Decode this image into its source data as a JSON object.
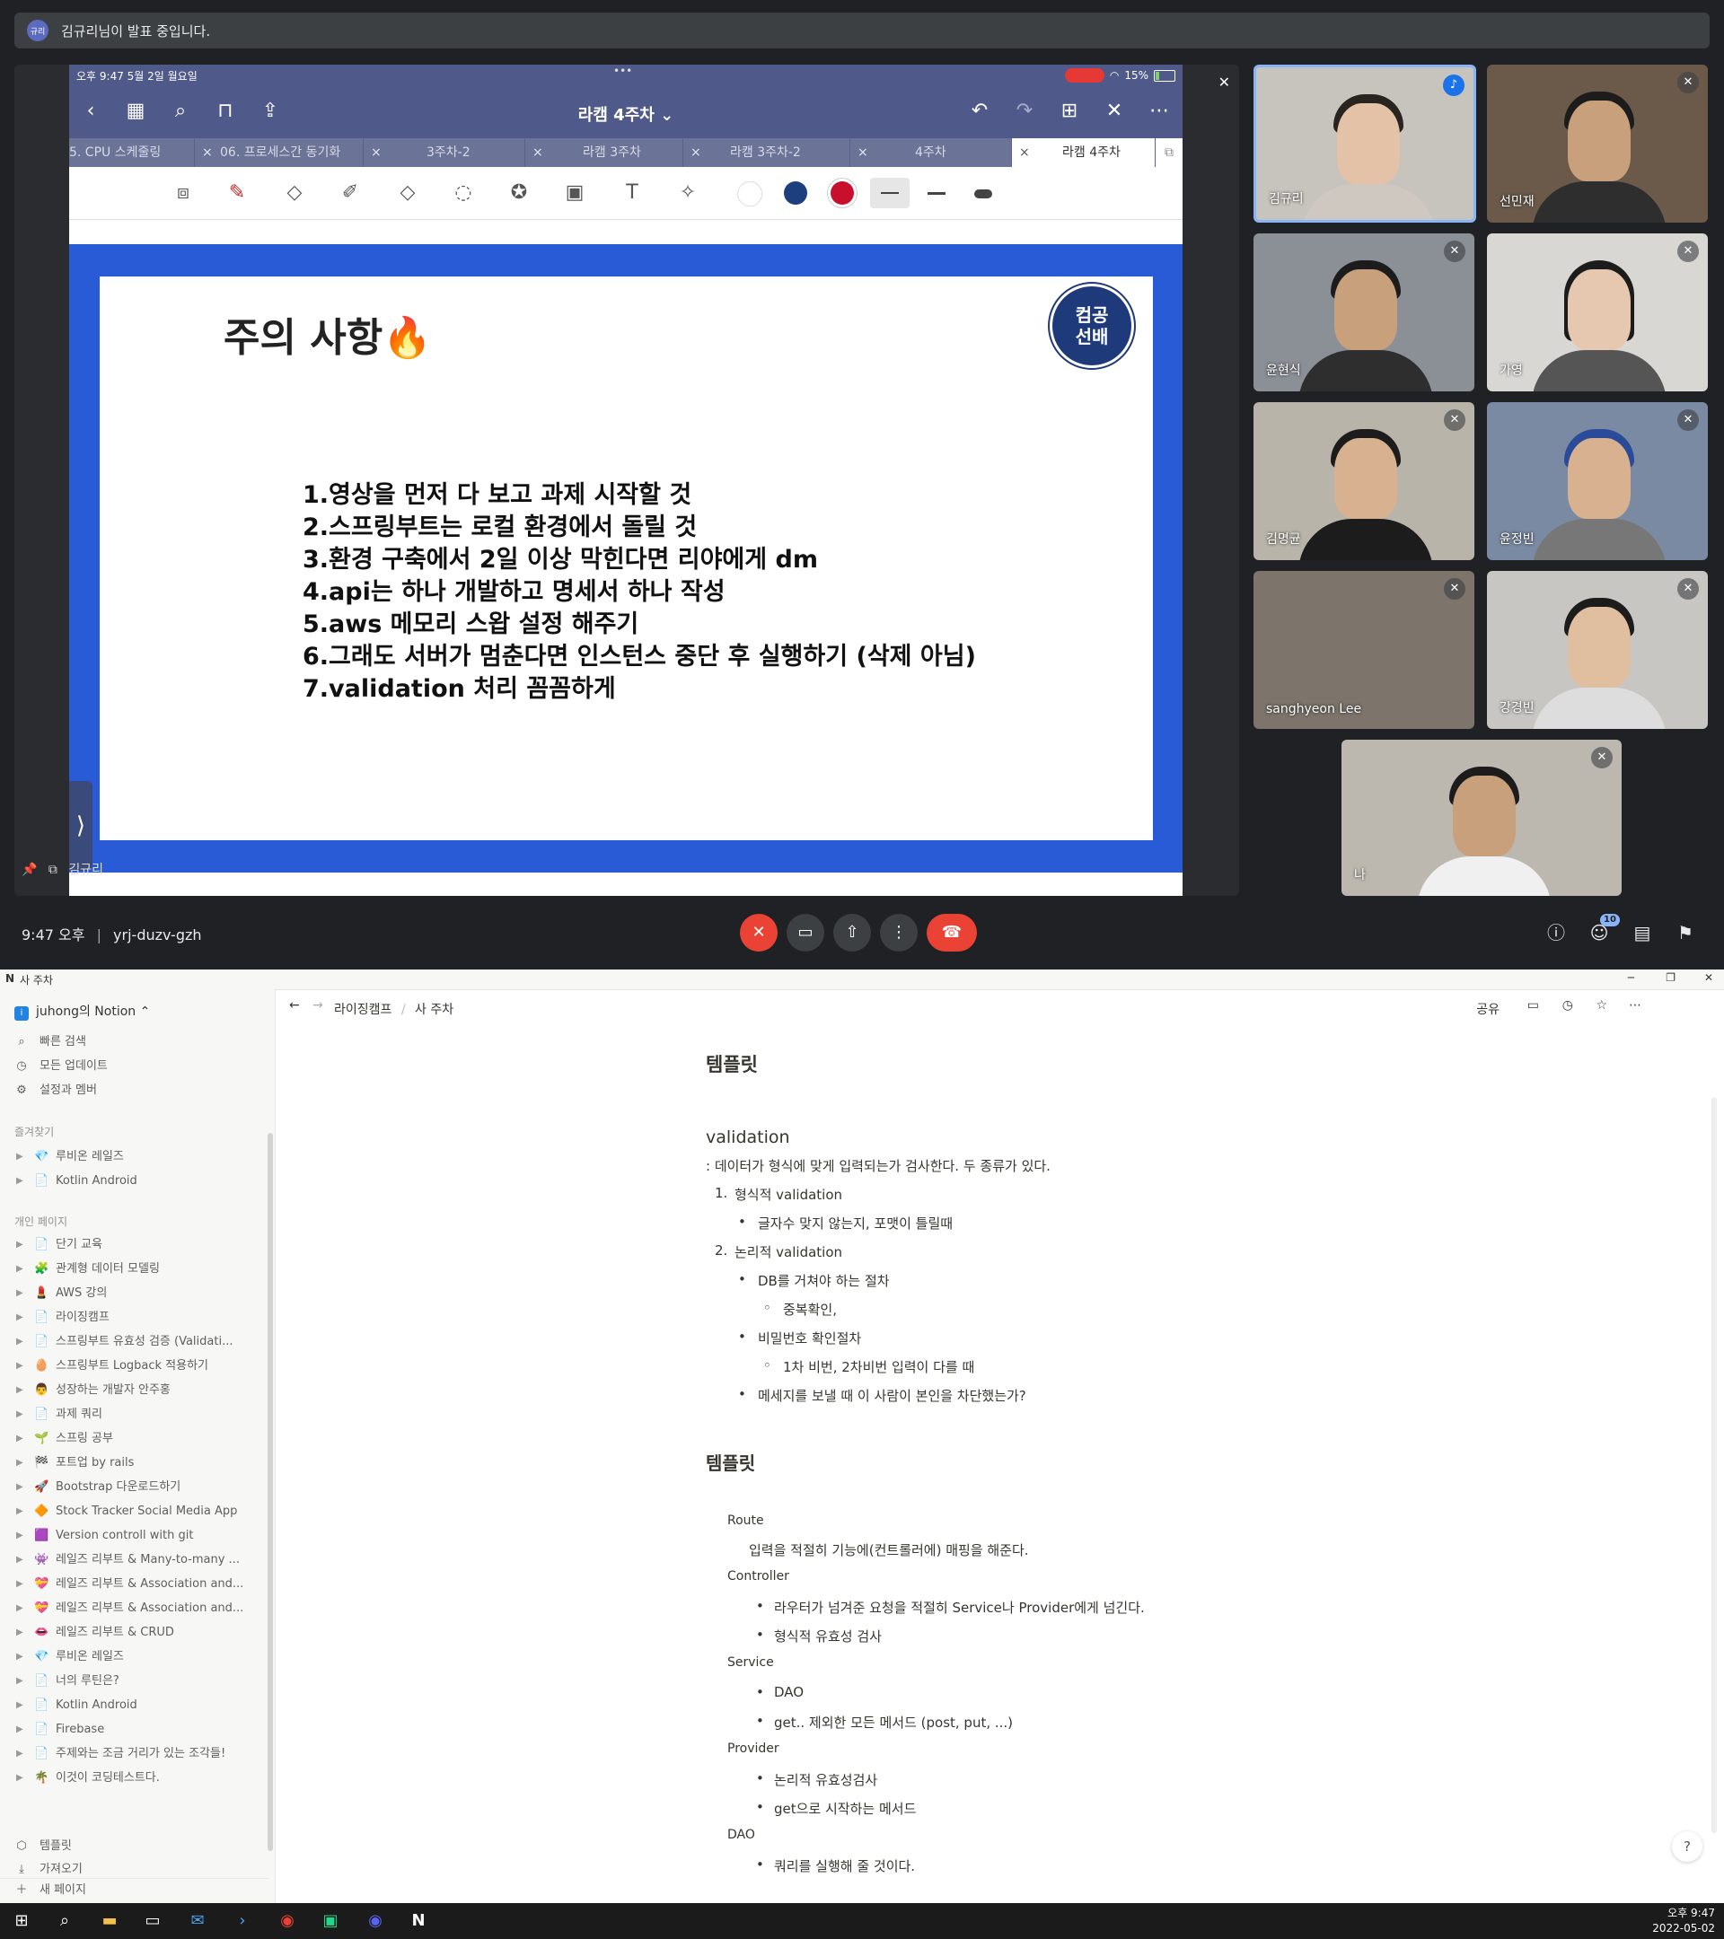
{
  "banner": {
    "avatar": "규리",
    "text": "김규리님이 발표 중입니다."
  },
  "ipad": {
    "status_time": "오후 9:47   5월 2일 월요일",
    "battery": "15%",
    "doc_title": "라캠 4주차 ⌄",
    "tabs": [
      "5. CPU 스케줄링",
      "06. 프로세스간 동기화",
      "3주차-2",
      "라캠 3주차",
      "라캠 3주차-2",
      "4주차",
      "라캠 4주차"
    ],
    "colors": {
      "toolbar": "#4f5a8a",
      "tabs": "#6b7396",
      "slide_frame": "#2a5bd7"
    }
  },
  "slide": {
    "title": "주의 사항🔥",
    "logo_line1": "컴공",
    "logo_line2": "선배",
    "items": [
      "1.영상을 먼저 다 보고 과제 시작할 것",
      "2.스프링부트는 로컬 환경에서 돌릴 것",
      "3.환경 구축에서 2일 이상 막힌다면 리야에게 dm",
      "4.api는 하나 개발하고 명세서 하나 작성",
      "5.aws 메모리 스왑 설정 해주기",
      "6.그래도 서버가 멈춘다면 인스턴스 중단 후 실행하기 (삭제 아님)",
      "7.validation 처리 꼼꼼하게"
    ]
  },
  "presenter_label": "김규리",
  "participants": [
    "김규리",
    "선민재",
    "윤현식",
    "가영",
    "김명균",
    "윤정빈",
    "sanghyeon Lee",
    "강경빈",
    "나"
  ],
  "meet_bar": {
    "time": "9:47 오후",
    "code": "yrj-duzv-gzh",
    "people_count": "10"
  },
  "notion": {
    "window_title": "사 주차",
    "workspace": "juhong의 Notion",
    "nav": [
      "빠른 검색",
      "모든 업데이트",
      "설정과 멤버"
    ],
    "favorites_label": "즐겨찾기",
    "favorites": [
      {
        "icon": "💎",
        "label": "루비온 레일즈"
      },
      {
        "icon": "📄",
        "label": "Kotlin Android"
      }
    ],
    "private_label": "개인 페이지",
    "pages": [
      {
        "icon": "📄",
        "label": "단기 교육"
      },
      {
        "icon": "🧩",
        "label": "관계형 데이터 모델링"
      },
      {
        "icon": "💄",
        "label": "AWS 강의"
      },
      {
        "icon": "📄",
        "label": "라이징캠프"
      },
      {
        "icon": "📄",
        "label": "스프링부트 유효성 검증 (Validati..."
      },
      {
        "icon": "🥚",
        "label": "스프링부트 Logback 적용하기"
      },
      {
        "icon": "👨",
        "label": "성장하는 개발자 안주홍"
      },
      {
        "icon": "📄",
        "label": "과제 쿼리"
      },
      {
        "icon": "🌱",
        "label": "스프링 공부"
      },
      {
        "icon": "🏁",
        "label": "포트업 by rails"
      },
      {
        "icon": "🚀",
        "label": "Bootstrap 다운로드하기"
      },
      {
        "icon": "🔶",
        "label": "Stock Tracker Social Media App"
      },
      {
        "icon": "🟪",
        "label": "Version controll with git"
      },
      {
        "icon": "👾",
        "label": "레일즈 리부트 & Many-to-many ..."
      },
      {
        "icon": "💝",
        "label": "레일즈 리부트 & Association and..."
      },
      {
        "icon": "💝",
        "label": "레일즈 리부트 & Association and..."
      },
      {
        "icon": "👄",
        "label": "레일즈 리부트 & CRUD"
      },
      {
        "icon": "💎",
        "label": "루비온 레일즈"
      },
      {
        "icon": "📄",
        "label": "너의 루틴은?"
      },
      {
        "icon": "📄",
        "label": "Kotlin Android"
      },
      {
        "icon": "📄",
        "label": "Firebase"
      },
      {
        "icon": "📄",
        "label": "주제와는 조금 거리가 있는 조각들!"
      },
      {
        "icon": "🌴",
        "label": "이것이 코딩테스트다."
      }
    ],
    "bottom": [
      "템플릿",
      "가져오기",
      "새 페이지"
    ],
    "breadcrumb": [
      "라이징캠프",
      "사 주차"
    ],
    "top_actions": {
      "share": "공유"
    },
    "content": {
      "h_template1": "템플릿",
      "h_validation": "validation",
      "desc": ": 데이터가 형식에 맞게 입력되는가 검사한다. 두 종류가 있다.",
      "n1": "1.",
      "n1_text": "형식적 validation",
      "n1_b1": "글자수 맞지 않는지, 포맷이 틀릴때",
      "n2": "2.",
      "n2_text": "논리적 validation",
      "n2_b1": "DB를 거쳐야 하는 절차",
      "n2_b1_s1": "중복확인,",
      "n2_b2": "비밀번호 확인절차",
      "n2_b2_s1": "1차 비번, 2차비번 입력이 다를 때",
      "n2_b3": "메세지를 보낼 때 이 사람이 본인을 차단했는가?",
      "h_template2": "템플릿",
      "route": "Route",
      "route_desc": "입력을 적절히 기능에(컨트롤러에) 매핑을 해준다.",
      "controller": "Controller",
      "controller_b1": "라우터가 넘겨준 요청을 적절히 Service나 Provider에게 넘긴다.",
      "controller_b2": " 형식적 유효성 검사",
      "service": "Service",
      "service_b1": "DAO",
      "service_b2": "get.. 제외한 모든 메서드 (post, put, ...)",
      "provider": "Provider",
      "provider_b1": "논리적 유효성검사",
      "provider_b2": "get으로 시작하는 메서드",
      "dao": "DAO",
      "dao_b1": "쿼리를 실행해 줄 것이다."
    },
    "help": "?"
  },
  "taskbar": {
    "time": "오후 9:47",
    "date": "2022-05-02"
  }
}
